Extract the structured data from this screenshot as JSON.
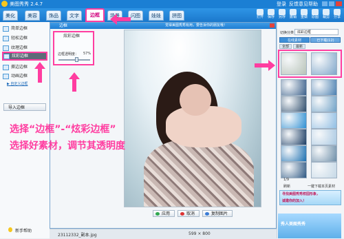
{
  "colors": {
    "accent": "#ff3da0",
    "titlebar": "#1b7fd4",
    "nav": "#2f95e6",
    "link": "#1a68b8"
  },
  "app": {
    "title": "美图秀秀 2.4.7",
    "links": [
      "登录",
      "反馈意见",
      "帮助"
    ]
  },
  "nav": {
    "tabs": [
      "美化",
      "美容",
      "饰品",
      "文字",
      "边框",
      "场景",
      "闪图",
      "娃娃",
      "拼图"
    ],
    "active_index": 4,
    "tools": [
      "打开",
      "保存",
      "另存",
      "撤销",
      "重做",
      "原图",
      "裁剪",
      "分享"
    ]
  },
  "left": {
    "items": [
      "简单边框",
      "轻松边框",
      "纹理边框",
      "炫彩边框",
      "撕边边框",
      "动画边框"
    ],
    "selected_index": 3,
    "custom_link": "▶ 自定义边框",
    "import_button": "导入边框",
    "help": "新手帮助"
  },
  "dialog": {
    "title": "边框",
    "banner": "觉得美图秀秀有用，要告诉你的朋友哦！",
    "settings_title": "炫彩边框",
    "opacity_label": "边框透明度：",
    "opacity_value": "57%",
    "opacity_level": 0.57,
    "buttons": [
      "应用",
      "取消",
      "复制图片"
    ],
    "button_icon_colors": [
      "#2fa84f",
      "#d33",
      "#3a7bd5"
    ]
  },
  "status": {
    "filename": "23112332_副本.jpg",
    "dimensions": "599 × 800"
  },
  "right": {
    "category_label": "切换分类",
    "category_value": "炫彩边框",
    "tabs": [
      "在线素材",
      "已下载(12)"
    ],
    "subtabs": [
      "全部",
      "最新"
    ],
    "thumb_colors": [
      "#b6c2b7",
      "#7fa6c9",
      "#3a5f8a",
      "#4a7fb0",
      "#2d4c6b",
      "#6fa1c6",
      "#2e8fd2",
      "#8fbde3",
      "#1a3c63",
      "#a9c8e2",
      "#1b6fb0",
      "#6d8ea8",
      "#2e5883",
      "#c5d8e6"
    ],
    "page": "1/9",
    "refresh": "刷新",
    "download": "一键下载本页素材",
    "promo_line1": "寻找美图秀秀校园形象，",
    "promo_line2": "诚邀你的加入！",
    "promo_bottom": "秀人美图秀秀"
  },
  "annotation": {
    "line1": "选择“边框”-“炫彩边框”",
    "line2": "选择好素材，调节其透明度"
  }
}
